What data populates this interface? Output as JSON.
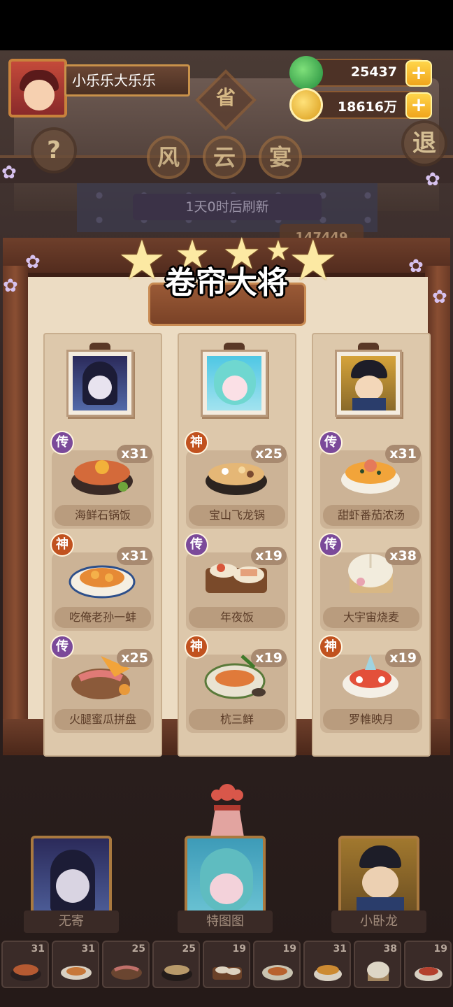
{
  "player": {
    "name": "小乐乐大乐乐"
  },
  "resources": {
    "jade": "25437",
    "coins": "18616万",
    "plus": "+"
  },
  "header": {
    "sheng": "省",
    "title_chars": [
      "风",
      "云",
      "宴"
    ],
    "help": "?",
    "exit": "退",
    "refresh_text": "1天0时后刷新",
    "score": "147449"
  },
  "popup": {
    "title": "卷帘大将",
    "columns": [
      {
        "dishes": [
          {
            "rank": "传",
            "rank_type": "chuan",
            "qty": "x31",
            "name": "海鲜石锅饭"
          },
          {
            "rank": "神",
            "rank_type": "shen",
            "qty": "x31",
            "name": "吃俺老孙一蚌"
          },
          {
            "rank": "传",
            "rank_type": "chuan",
            "qty": "x25",
            "name": "火腿蜜瓜拼盘"
          }
        ]
      },
      {
        "dishes": [
          {
            "rank": "神",
            "rank_type": "shen",
            "qty": "x25",
            "name": "宝山飞龙锅"
          },
          {
            "rank": "传",
            "rank_type": "chuan",
            "qty": "x19",
            "name": "年夜饭"
          },
          {
            "rank": "神",
            "rank_type": "shen",
            "qty": "x19",
            "name": "杭三鲜"
          }
        ]
      },
      {
        "dishes": [
          {
            "rank": "传",
            "rank_type": "chuan",
            "qty": "x31",
            "name": "甜虾番茄浓汤"
          },
          {
            "rank": "传",
            "rank_type": "chuan",
            "qty": "x38",
            "name": "大宇宙烧麦"
          },
          {
            "rank": "神",
            "rank_type": "shen",
            "qty": "x19",
            "name": "罗帷映月"
          }
        ]
      }
    ]
  },
  "heroes": [
    {
      "name": "无寄"
    },
    {
      "name": "特图图"
    },
    {
      "name": "小卧龙"
    }
  ],
  "tray": [
    "31",
    "31",
    "25",
    "25",
    "19",
    "19",
    "31",
    "38",
    "19"
  ]
}
